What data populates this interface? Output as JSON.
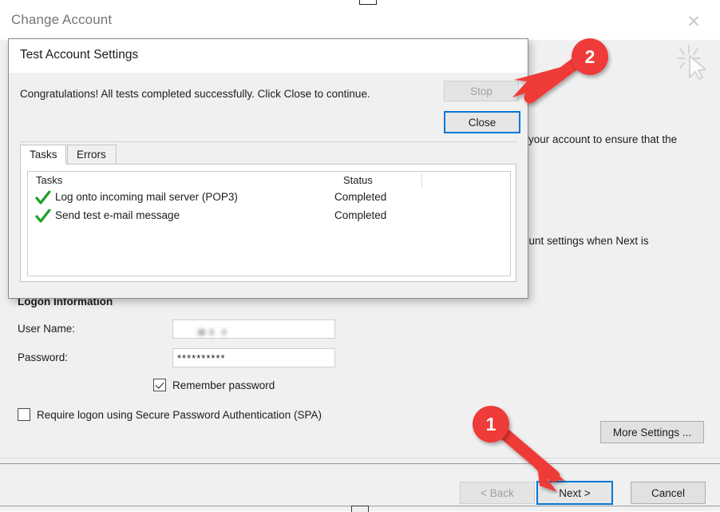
{
  "wizard": {
    "title": "Change Account",
    "close_icon": "close-icon",
    "cursor_icon": "click-cursor-icon",
    "background_text": {
      "fragment_1": "your account to ensure that the",
      "fragment_2": "ount settings when Next is"
    },
    "logon_section": {
      "heading": "Logon Information",
      "username_label": "User Name:",
      "username_value": "",
      "username_placeholder": "",
      "password_label": "Password:",
      "password_value": "**********",
      "remember_password_label": "Remember password",
      "remember_password_checked": true,
      "spa_label": "Require logon using Secure Password Authentication (SPA)",
      "spa_checked": false
    },
    "more_settings_label": "More Settings ...",
    "footer": {
      "back_label": "< Back",
      "back_disabled": true,
      "next_label": "Next >",
      "next_focused": true,
      "cancel_label": "Cancel"
    }
  },
  "test_dialog": {
    "title": "Test Account Settings",
    "message": "Congratulations! All tests completed successfully. Click Close to continue.",
    "stop_label": "Stop",
    "stop_disabled": true,
    "close_label": "Close",
    "close_focused": true,
    "tabs": [
      {
        "label": "Tasks",
        "active": true
      },
      {
        "label": "Errors",
        "active": false
      }
    ],
    "list": {
      "columns": [
        "Tasks",
        "Status"
      ],
      "rows": [
        {
          "icon": "green-check-icon",
          "task": "Log onto incoming mail server (POP3)",
          "status": "Completed"
        },
        {
          "icon": "green-check-icon",
          "task": "Send test e-mail message",
          "status": "Completed"
        }
      ]
    }
  },
  "annotations": [
    {
      "number": "2",
      "target": "close-button"
    },
    {
      "number": "1",
      "target": "next-button"
    }
  ],
  "colors": {
    "accent_focus": "#0078d7",
    "callout_red": "#ef3b39",
    "check_green": "#1e9e27",
    "window_bg": "#f0f0f0",
    "title_gray": "#767676"
  }
}
